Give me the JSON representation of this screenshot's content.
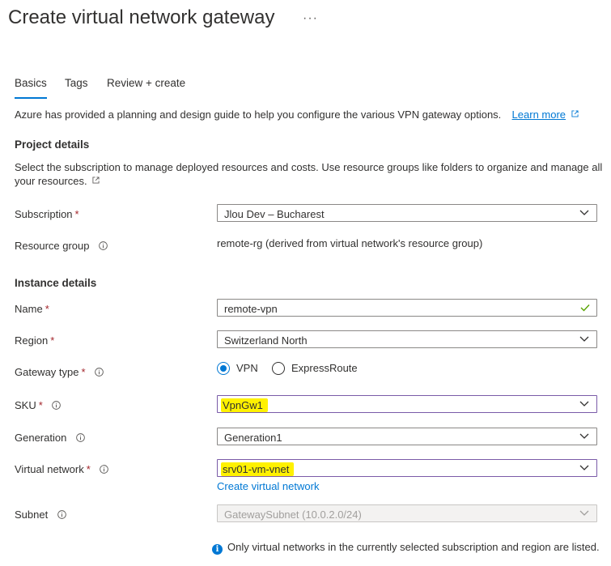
{
  "header": {
    "title": "Create virtual network gateway",
    "more": "···"
  },
  "tabs": [
    {
      "label": "Basics",
      "active": true
    },
    {
      "label": "Tags",
      "active": false
    },
    {
      "label": "Review + create",
      "active": false
    }
  ],
  "intro": {
    "text": "Azure has provided a planning and design guide to help you configure the various VPN gateway options.",
    "link": "Learn more"
  },
  "project": {
    "heading": "Project details",
    "desc_line1": "Select the subscription to manage deployed resources and costs. Use resource groups like folders to organize and manage all",
    "desc_line2": "your resources."
  },
  "fields": {
    "subscription": {
      "label": "Subscription",
      "value": "Jlou Dev – Bucharest"
    },
    "resource_group": {
      "label": "Resource group",
      "value": "remote-rg (derived from virtual network's resource group)"
    },
    "name": {
      "label": "Name",
      "value": "remote-vpn"
    },
    "region": {
      "label": "Region",
      "value": "Switzerland North"
    },
    "gateway_type": {
      "label": "Gateway type",
      "options": [
        "VPN",
        "ExpressRoute"
      ],
      "selected": "VPN"
    },
    "sku": {
      "label": "SKU",
      "value": "VpnGw1"
    },
    "generation": {
      "label": "Generation",
      "value": "Generation1"
    },
    "virtual_network": {
      "label": "Virtual network",
      "value": "srv01-vm-vnet",
      "create_link": "Create virtual network"
    },
    "subnet": {
      "label": "Subnet",
      "value": "GatewaySubnet (10.0.2.0/24)"
    }
  },
  "instance": {
    "heading": "Instance details"
  },
  "note": {
    "text": "Only virtual networks in the currently selected subscription and region are listed."
  },
  "colors": {
    "accent": "#0078d4",
    "required": "#a4262c",
    "highlight": "#fff100",
    "valid": "#57a300"
  }
}
